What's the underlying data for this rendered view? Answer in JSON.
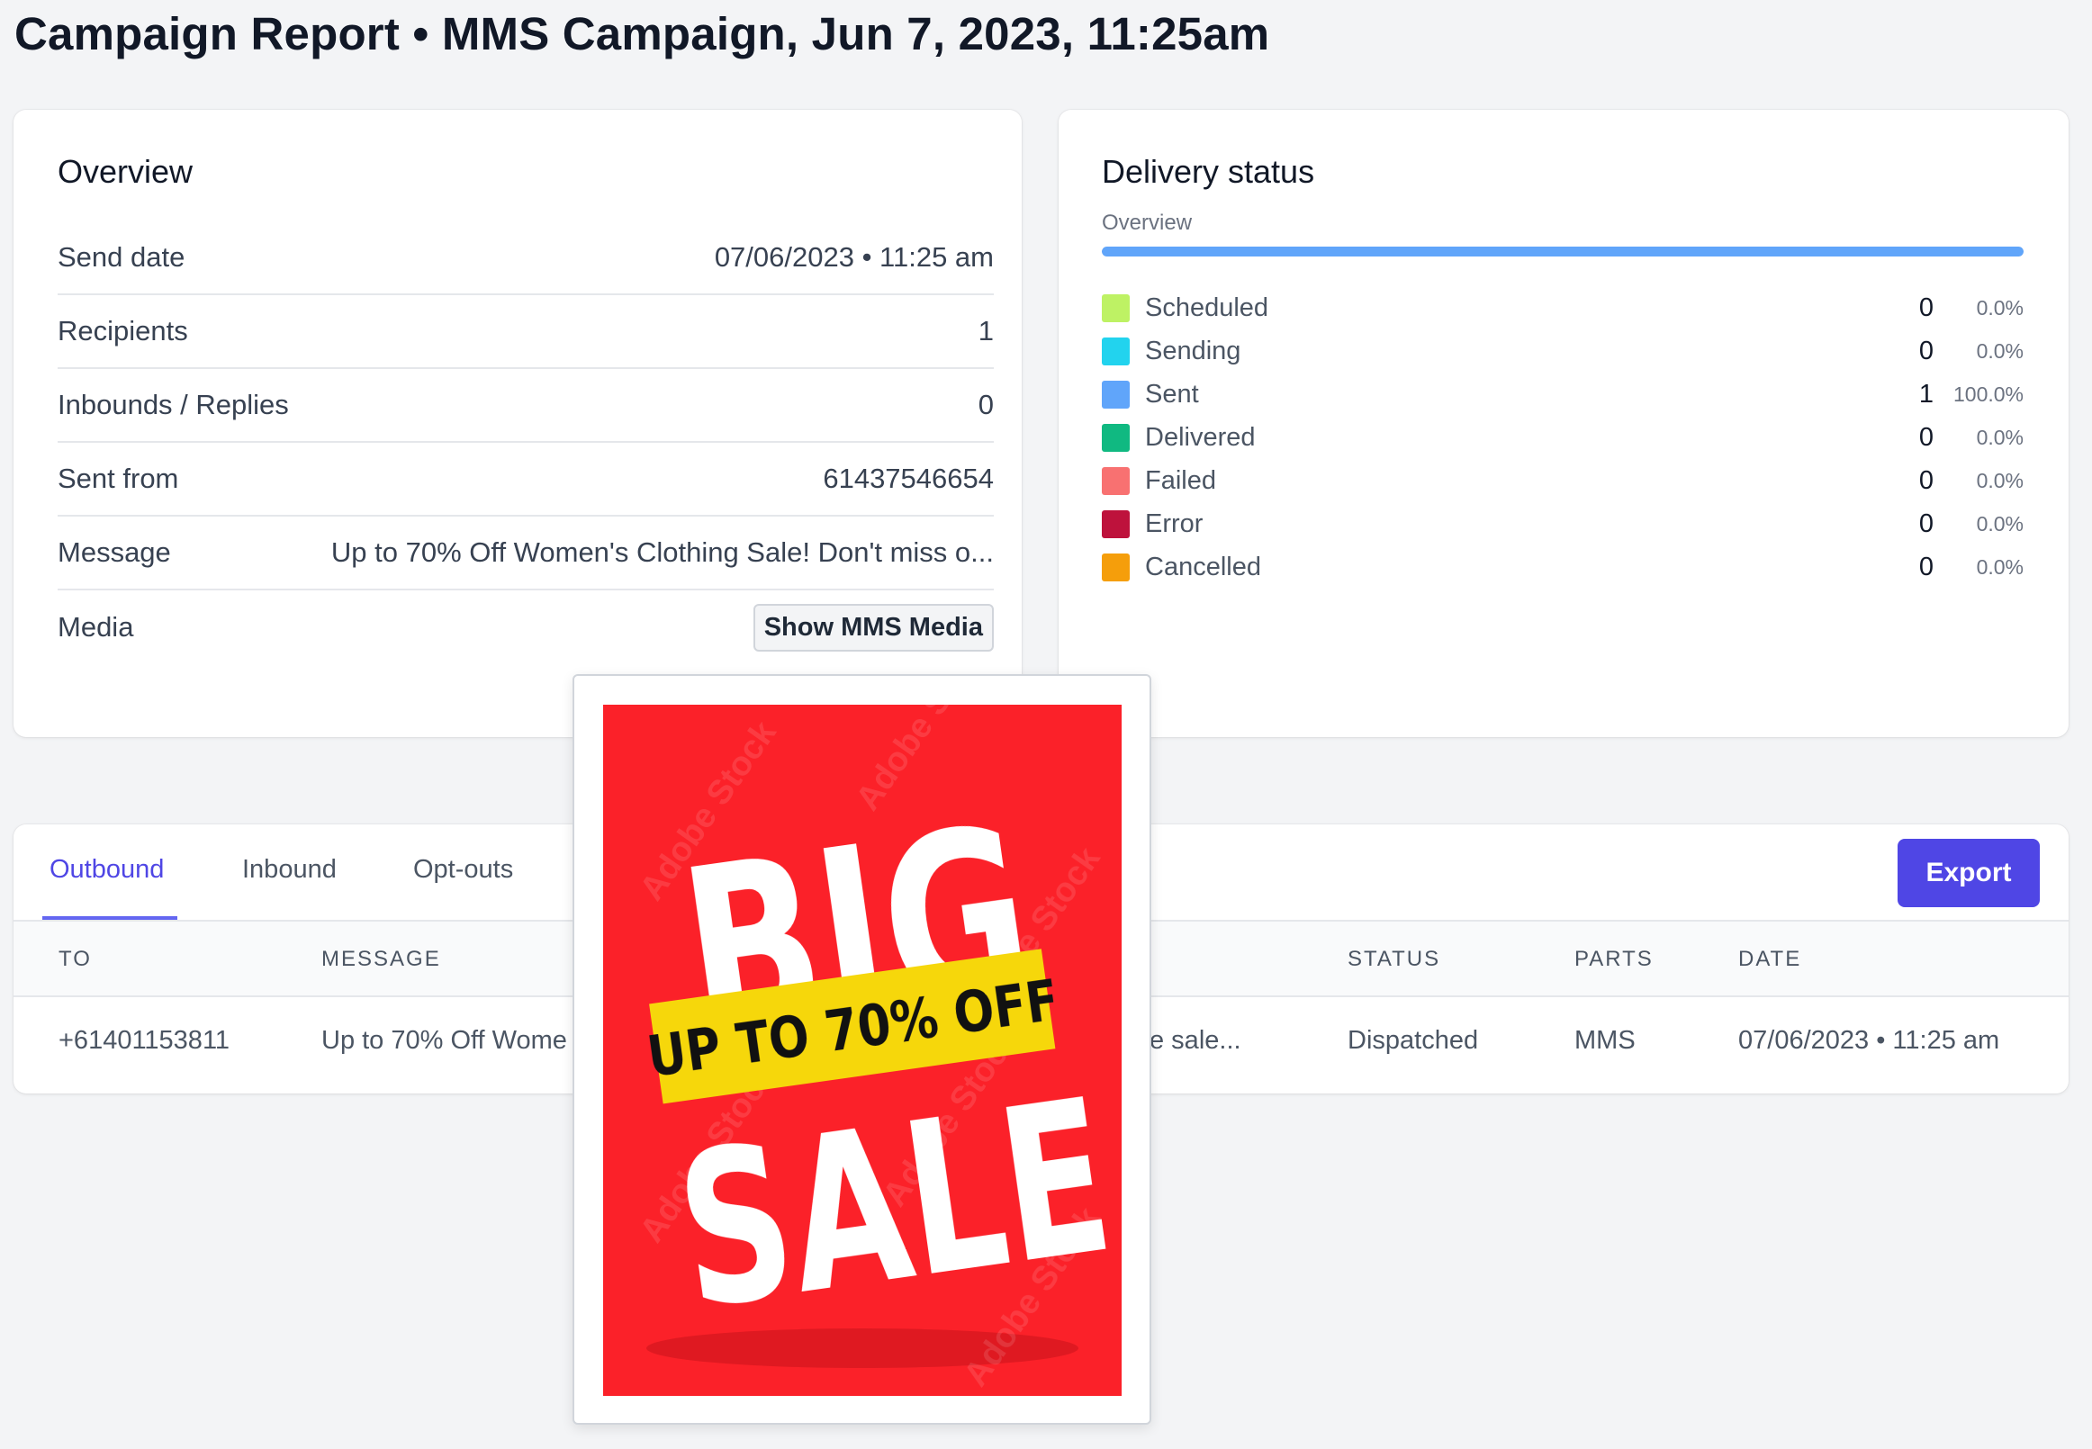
{
  "page": {
    "title": "Campaign Report • MMS Campaign, Jun 7, 2023, 11:25am"
  },
  "overview": {
    "heading": "Overview",
    "rows": [
      {
        "label": "Send date",
        "value": "07/06/2023 • 11:25 am"
      },
      {
        "label": "Recipients",
        "value": "1"
      },
      {
        "label": "Inbounds / Replies",
        "value": "0"
      },
      {
        "label": "Sent from",
        "value": "61437546654"
      },
      {
        "label": "Message",
        "value": "Up to 70% Off Women's Clothing Sale! Don't miss o..."
      },
      {
        "label": "Media",
        "value": ""
      }
    ],
    "media_button": "Show MMS Media"
  },
  "delivery": {
    "heading": "Delivery status",
    "subheading": "Overview",
    "progress_fraction": 1.0,
    "progress_color": "#60a5fa",
    "statuses": [
      {
        "name": "Scheduled",
        "count": "0",
        "percent": "0.0%",
        "color": "#bef264"
      },
      {
        "name": "Sending",
        "count": "0",
        "percent": "0.0%",
        "color": "#22d3ee"
      },
      {
        "name": "Sent",
        "count": "1",
        "percent": "100.0%",
        "color": "#60a5fa"
      },
      {
        "name": "Delivered",
        "count": "0",
        "percent": "0.0%",
        "color": "#10b981"
      },
      {
        "name": "Failed",
        "count": "0",
        "percent": "0.0%",
        "color": "#f87171"
      },
      {
        "name": "Error",
        "count": "0",
        "percent": "0.0%",
        "color": "#be123c"
      },
      {
        "name": "Cancelled",
        "count": "0",
        "percent": "0.0%",
        "color": "#f59e0b"
      }
    ]
  },
  "table": {
    "tabs": [
      {
        "label": "Outbound",
        "active": true
      },
      {
        "label": "Inbound",
        "active": false
      },
      {
        "label": "Opt-outs",
        "active": false
      }
    ],
    "export_label": "Export",
    "columns": {
      "to": "TO",
      "message": "MESSAGE",
      "status": "STATUS",
      "parts": "PARTS",
      "date": "DATE"
    },
    "rows": [
      {
        "to": "+61401153811",
        "message_visible": "Up to 70% Off Wome",
        "message_tail": "e sale...",
        "status": "Dispatched",
        "parts": "MMS",
        "date": "07/06/2023 • 11:25 am"
      }
    ]
  },
  "media_popup": {
    "image_text": {
      "big": "BIG",
      "ribbon": "UP TO 70% OFF",
      "sale": "SALE",
      "watermark": "Adobe Stock"
    },
    "colors": {
      "background": "#fb2129",
      "ribbon": "#f6d70b",
      "text": "#ffffff"
    }
  }
}
